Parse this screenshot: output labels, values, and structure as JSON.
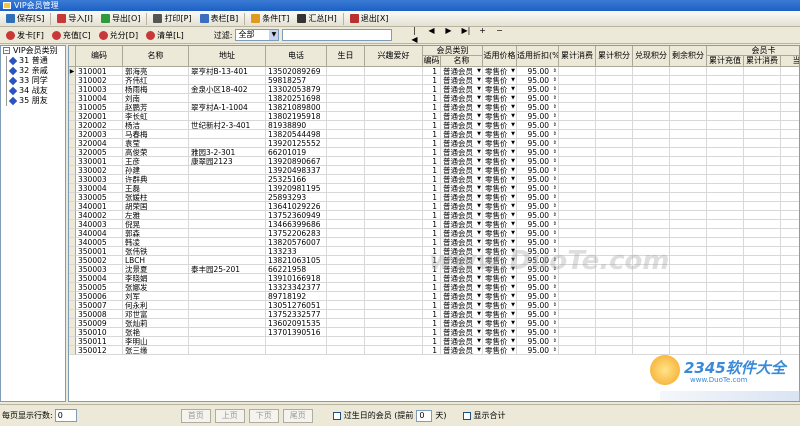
{
  "window": {
    "title": "VIP会员管理"
  },
  "toolbar": [
    {
      "key": "save",
      "label": "保存[S]",
      "icon": "save-icon",
      "color": "#2f6fb8"
    },
    {
      "key": "import",
      "label": "导入[I]",
      "icon": "import-icon",
      "color": "#c83838"
    },
    {
      "key": "export",
      "label": "导出[O]",
      "icon": "export-icon",
      "color": "#2f9a3a"
    },
    {
      "key": "print",
      "label": "打印[P]",
      "icon": "print-icon",
      "color": "#555555"
    },
    {
      "key": "columns",
      "label": "表栏[B]",
      "icon": "table-icon",
      "color": "#3a6fc0"
    },
    {
      "key": "condition",
      "label": "条件[T]",
      "icon": "filter-icon",
      "color": "#e09a20"
    },
    {
      "key": "summary",
      "label": "汇总[H]",
      "icon": "sigma-icon",
      "color": "#333333"
    },
    {
      "key": "exit",
      "label": "退出[X]",
      "icon": "exit-icon",
      "color": "#b83030"
    }
  ],
  "toolbar2": {
    "buttons": [
      {
        "key": "issue",
        "label": "发卡[F]",
        "icon": "issue-card-icon",
        "color": "#c83838"
      },
      {
        "key": "recharge",
        "label": "充值[C]",
        "icon": "recharge-icon",
        "color": "#c83838"
      },
      {
        "key": "redeem",
        "label": "兑分[D]",
        "icon": "redeem-icon",
        "color": "#c83838"
      },
      {
        "key": "list",
        "label": "清单[L]",
        "icon": "list-icon",
        "color": "#c83838"
      }
    ],
    "filter_label": "过滤:",
    "filter_value": "全部",
    "nav": [
      "|◀",
      "◀",
      "▶",
      "▶|",
      "+",
      "−"
    ]
  },
  "tree": {
    "root": "VIP会员类别",
    "items": [
      "31 普通",
      "32 亲戚",
      "33 同学",
      "34 战友",
      "35 朋友"
    ]
  },
  "grid": {
    "group_member_type": "会员类别",
    "group_member_card": "会员卡",
    "columns": {
      "code": "编码",
      "name": "名称",
      "address": "地址",
      "phone": "电话",
      "birthday": "生日",
      "hobby": "兴趣爱好",
      "type_code": "编码",
      "type_name": "名称",
      "price": "适用价格",
      "discount": "适用折扣(%)",
      "total_spend": "累计消费",
      "total_points": "累计积分",
      "redeemed_points": "兑现积分",
      "remaining_points": "剩余积分",
      "card_recharge": "累计充值",
      "card_spend": "累计消费",
      "card_current": "当前"
    },
    "default_type_code": "1",
    "default_type_name": "普通会员",
    "default_price": "零售价",
    "default_discount": "95.00",
    "rows": [
      {
        "code": "310001",
        "name": "郭海亮",
        "address": "翠亨村B-13-401",
        "phone": "13502089269"
      },
      {
        "code": "310002",
        "name": "齐伟红",
        "address": "",
        "phone": "59818257"
      },
      {
        "code": "310003",
        "name": "杨雨梅",
        "address": "金泉小区18-402",
        "phone": "13302053879"
      },
      {
        "code": "310004",
        "name": "刘南",
        "address": "",
        "phone": "13820251698"
      },
      {
        "code": "310005",
        "name": "赵鹏芳",
        "address": "翠亨村A-1-1004",
        "phone": "13821089800"
      },
      {
        "code": "320001",
        "name": "李长虹",
        "address": "",
        "phone": "13802195918"
      },
      {
        "code": "320002",
        "name": "杨洁",
        "address": "世纪新村2-3-401",
        "phone": "81938890"
      },
      {
        "code": "320003",
        "name": "马春梅",
        "address": "",
        "phone": "13820544498"
      },
      {
        "code": "320004",
        "name": "袁莹",
        "address": "",
        "phone": "13920125552"
      },
      {
        "code": "320005",
        "name": "高俊荣",
        "address": "雅园3-2-301",
        "phone": "66201019"
      },
      {
        "code": "330001",
        "name": "王彦",
        "address": "康翠园2123",
        "phone": "13920890667"
      },
      {
        "code": "330002",
        "name": "孙建",
        "address": "",
        "phone": "13920498337"
      },
      {
        "code": "330003",
        "name": "许群典",
        "address": "",
        "phone": "25325166"
      },
      {
        "code": "330004",
        "name": "王磊",
        "address": "",
        "phone": "13920981195"
      },
      {
        "code": "330005",
        "name": "张媛柱",
        "address": "",
        "phone": "25893293"
      },
      {
        "code": "340001",
        "name": "胡荣国",
        "address": "",
        "phone": "13641029226"
      },
      {
        "code": "340002",
        "name": "左雅",
        "address": "",
        "phone": "13752360949"
      },
      {
        "code": "340003",
        "name": "倪晃",
        "address": "",
        "phone": "13466399686"
      },
      {
        "code": "340004",
        "name": "郭森",
        "address": "",
        "phone": "13752206283"
      },
      {
        "code": "340005",
        "name": "韩凌",
        "address": "",
        "phone": "13820576007"
      },
      {
        "code": "350001",
        "name": "张伟铁",
        "address": "",
        "phone": "133233"
      },
      {
        "code": "350002",
        "name": "LBCH",
        "address": "",
        "phone": "13821063105"
      },
      {
        "code": "350003",
        "name": "沈景夏",
        "address": "泰丰园25-201",
        "phone": "66221958"
      },
      {
        "code": "350004",
        "name": "李晓娟",
        "address": "",
        "phone": "13910166918"
      },
      {
        "code": "350005",
        "name": "张娜发",
        "address": "",
        "phone": "13323342377"
      },
      {
        "code": "350006",
        "name": "刘军",
        "address": "",
        "phone": "89718192"
      },
      {
        "code": "350007",
        "name": "何永利",
        "address": "",
        "phone": "13051276051"
      },
      {
        "code": "350008",
        "name": "邓世富",
        "address": "",
        "phone": "13752332577"
      },
      {
        "code": "350009",
        "name": "张灿莉",
        "address": "",
        "phone": "13602091535"
      },
      {
        "code": "350010",
        "name": "张艳",
        "address": "",
        "phone": "13701390516"
      },
      {
        "code": "350011",
        "name": "李明山",
        "address": "",
        "phone": ""
      },
      {
        "code": "350012",
        "name": "张三缘",
        "address": "",
        "phone": ""
      }
    ]
  },
  "watermark": "www.DuoTe.com",
  "logo": {
    "brand": "2345软件大全",
    "url": "www.DuoTe.com"
  },
  "statusbar": {
    "rows_label": "每页显示行数:",
    "rows_value": "0",
    "pager": [
      "首页",
      "上页",
      "下页",
      "尾页"
    ],
    "birthday_label_pre": "过生日的会员 (提前",
    "birthday_days": "0",
    "birthday_label_post": "天)",
    "show_total_label": "显示合计"
  }
}
